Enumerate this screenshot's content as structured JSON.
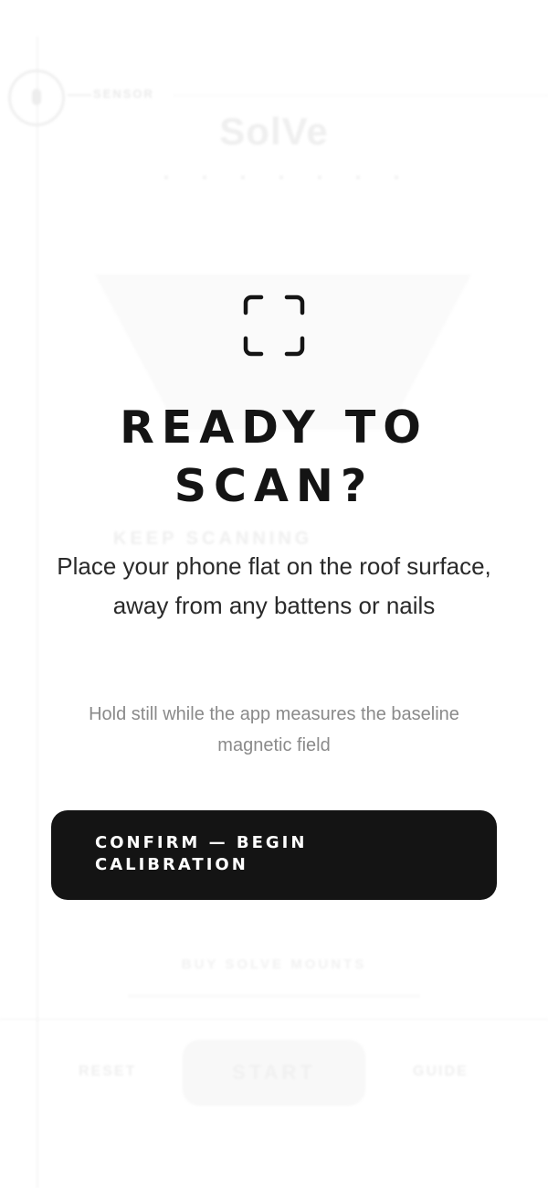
{
  "background": {
    "sensor_label": "SENSOR",
    "brand": "SolVe",
    "keep_scanning": "KEEP SCANNING",
    "buy_mounts": "BUY SOLVE MOUNTS",
    "bottom_nav": {
      "reset": "RESET",
      "start": "START",
      "guide": "GUIDE"
    }
  },
  "dialog": {
    "icon": "scan-frame-icon",
    "title_line1": "READY TO",
    "title_line2": "SCAN?",
    "lead": "Place your phone flat on the roof surface, away from any battens or nails",
    "note": "Hold still while the app measures the baseline magnetic field",
    "confirm_line1": "CONFIRM — BEGIN",
    "confirm_line2": "CALIBRATION"
  },
  "colors": {
    "primary_button": "#141414",
    "title_text": "#141414",
    "note_text": "#8a8a8a"
  }
}
